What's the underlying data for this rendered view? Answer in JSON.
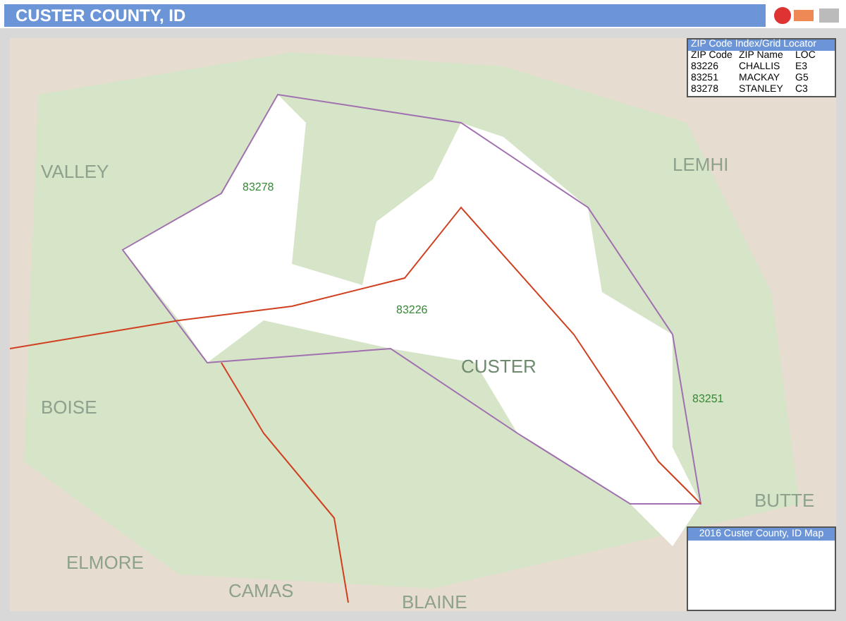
{
  "title": "CUSTER COUNTY, ID",
  "map": {
    "county_labels": [
      {
        "text": "VALLEY",
        "kind": "neighbor"
      },
      {
        "text": "LEMHI",
        "kind": "neighbor"
      },
      {
        "text": "CUSTER",
        "kind": "main"
      },
      {
        "text": "BOISE",
        "kind": "neighbor"
      },
      {
        "text": "BUTTE",
        "kind": "neighbor"
      },
      {
        "text": "ELMORE",
        "kind": "neighbor"
      },
      {
        "text": "CAMAS",
        "kind": "neighbor"
      },
      {
        "text": "BLAINE",
        "kind": "neighbor"
      }
    ],
    "zip_labels": [
      "83278",
      "83226",
      "83251"
    ]
  },
  "zip_index": {
    "title": "ZIP Code Index/Grid Locator",
    "columns": [
      "ZIP Code",
      "ZIP Name",
      "LOC"
    ],
    "rows": [
      [
        "83226",
        "CHALLIS",
        "E3"
      ],
      [
        "83251",
        "MACKAY",
        "G5"
      ],
      [
        "83278",
        "STANLEY",
        "C3"
      ]
    ]
  },
  "legend": {
    "title": "2016 Custer County, ID Map"
  }
}
